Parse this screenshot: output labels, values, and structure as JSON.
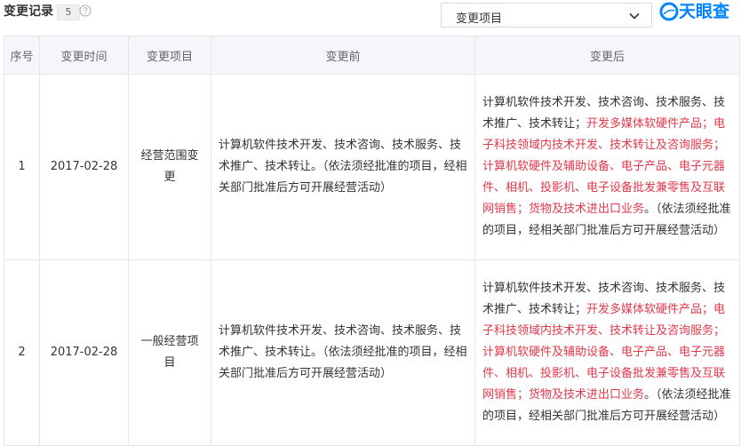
{
  "header": {
    "title": "变更记录",
    "count": "5",
    "filter_value": "变更项目",
    "logo_text": "天眼查"
  },
  "table": {
    "columns": [
      "序号",
      "变更时间",
      "变更项目",
      "变更前",
      "变更后"
    ],
    "rows": [
      {
        "index": "1",
        "date": "2017-02-28",
        "item": "经营范围变更",
        "before": "计算机软件技术开发、技术咨询、技术服务、技术推广、技术转让。（依法须经批准的项目，经相关部门批准后方可开展经营活动）",
        "after_prefix": "计算机软件技术开发、技术咨询、技术服务、技术推广、技术转让；",
        "after_highlight": "开发多媒体软硬件产品；电子科技领域内技术开发、技术转让及咨询服务；计算机软硬件及辅助设备、电子产品、电子元器件、相机、投影机、电子设备批发兼零售及互联网销售；货物及技术进出口业务",
        "after_suffix": "。（依法须经批准的项目，经相关部门批准后方可开展经营活动）"
      },
      {
        "index": "2",
        "date": "2017-02-28",
        "item": "一般经营项目",
        "before": "计算机软件技术开发、技术咨询、技术服务、技术推广、技术转让。（依法须经批准的项目，经相关部门批准后方可开展经营活动）",
        "after_prefix": "计算机软件技术开发、技术咨询、技术服务、技术推广、技术转让；",
        "after_highlight": "开发多媒体软硬件产品；电子科技领域内技术开发、技术转让及咨询服务；计算机软硬件及辅助设备、电子产品、电子元器件、相机、投影机、电子设备批发兼零售及互联网销售；货物及技术进出口业务",
        "after_suffix": "。（依法须经批准的项目，经相关部门批准后方可开展经营活动）"
      }
    ]
  },
  "icons": {
    "help": "help-circle-icon",
    "chevron": "chevron-down-icon",
    "logo": "tianyancha-logo-icon"
  },
  "colors": {
    "brand": "#0084ff",
    "highlight": "#e0384b",
    "header_bg": "#f4f6f9",
    "border": "#e6e6e6"
  }
}
